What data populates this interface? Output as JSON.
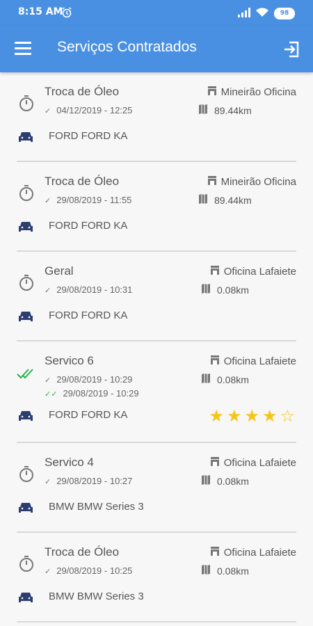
{
  "status": {
    "time": "8:15 AM",
    "battery": "98"
  },
  "appbar": {
    "title": "Serviços Contratados"
  },
  "services": [
    {
      "name": "Troca de Óleo",
      "date": "04/12/2019 - 12:25",
      "vehicle": "FORD FORD KA",
      "shop": "Mineirão Oficina",
      "distance": "89.44km"
    },
    {
      "name": "Troca de Óleo",
      "date": "29/08/2019 - 11:55",
      "vehicle": "FORD FORD KA",
      "shop": "Mineirão Oficina",
      "distance": "89.44km"
    },
    {
      "name": "Geral",
      "date": "29/08/2019 - 10:31",
      "vehicle": "FORD FORD KA",
      "shop": "Oficina Lafaiete",
      "distance": "0.08km"
    },
    {
      "name": "Servico 6",
      "date": "29/08/2019 - 10:29",
      "date2": "29/08/2019 - 10:29",
      "vehicle": "FORD FORD KA",
      "shop": "Oficina Lafaiete",
      "distance": "0.08km",
      "rating": 4,
      "rating_max": 5
    },
    {
      "name": "Servico 4",
      "date": "29/08/2019 - 10:27",
      "vehicle": "BMW BMW Series 3",
      "shop": "Oficina Lafaiete",
      "distance": "0.08km"
    },
    {
      "name": "Troca de Óleo",
      "date": "29/08/2019 - 10:25",
      "vehicle": "BMW BMW Series 3",
      "shop": "Oficina Lafaiete",
      "distance": "0.08km"
    }
  ]
}
